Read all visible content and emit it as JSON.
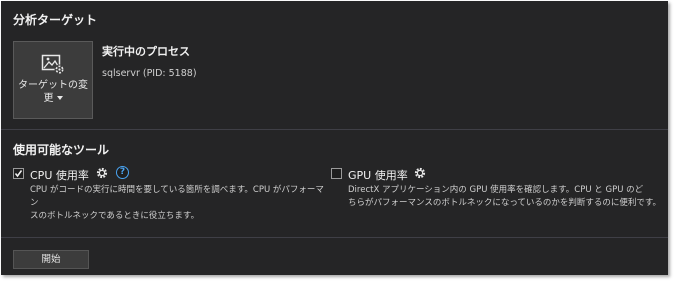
{
  "target_section": {
    "title": "分析ターゲット",
    "change_target_button": {
      "label_line1": "ターゲットの変",
      "label_line2": "更",
      "icon": "image-settings-icon"
    },
    "process_title": "実行中のプロセス",
    "process_name": "sqlservr (PID: 5188)"
  },
  "tools_section": {
    "title": "使用可能なツール",
    "tools": [
      {
        "name": "CPU 使用率",
        "checked": true,
        "has_help": true,
        "help_glyph": "?",
        "description_line1": "CPU がコードの実行に時間を要している箇所を調べます。CPU がパフォーマン",
        "description_line2": "スのボトルネックであるときに役立ちます。"
      },
      {
        "name": "GPU 使用率",
        "checked": false,
        "has_help": false,
        "description_line1": "DirectX アプリケーション内の GPU 使用率を確認します。CPU と GPU のど",
        "description_line2": "ちらがパフォーマンスのボトルネックになっているのかを判断するのに便利です。"
      }
    ]
  },
  "footer": {
    "start_button_label": "開始"
  },
  "colors": {
    "background": "#252526",
    "accent": "#4aa3f0",
    "text": "#f1f1f1"
  }
}
